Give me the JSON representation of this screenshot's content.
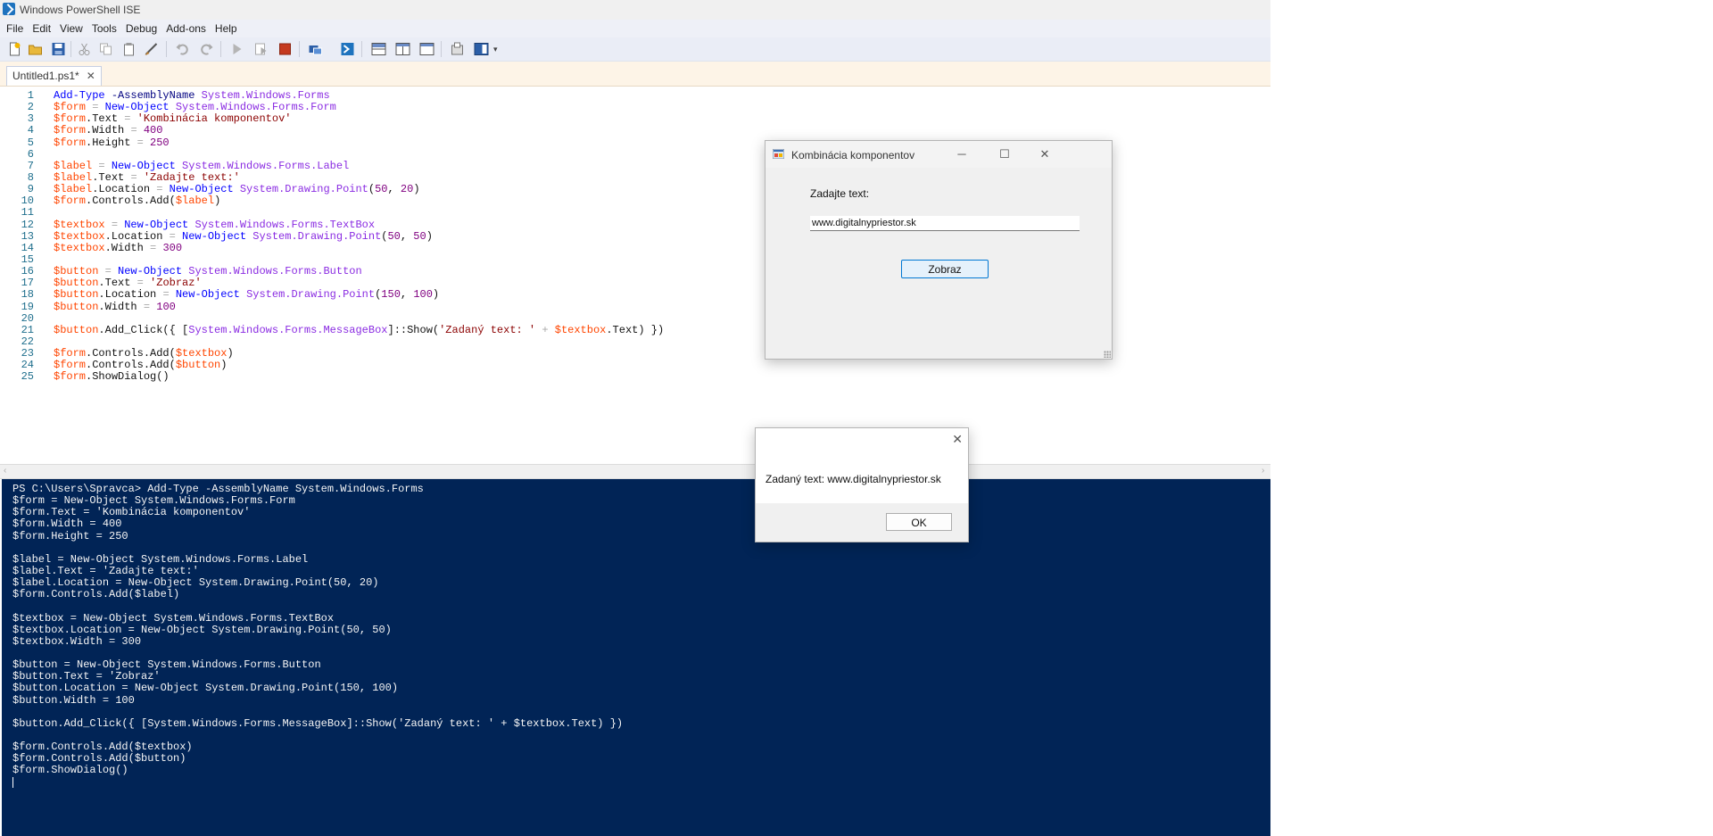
{
  "window": {
    "title": "Windows PowerShell ISE"
  },
  "menu": [
    "File",
    "Edit",
    "View",
    "Tools",
    "Debug",
    "Add-ons",
    "Help"
  ],
  "toolbar_icons": [
    "new-file-icon",
    "open-file-icon",
    "save-icon",
    "cut-icon",
    "copy-icon",
    "paste-icon",
    "clear-console-icon",
    "undo-icon",
    "redo-icon",
    "run-script-icon",
    "run-selection-icon",
    "stop-icon",
    "new-remote-tab-icon",
    "powershell-console-icon",
    "show-script-pane-top-icon",
    "show-script-pane-right-icon",
    "show-script-pane-maximized-icon",
    "command-addon-icon",
    "show-command-window-icon"
  ],
  "tab": {
    "label": "Untitled1.ps1*",
    "close": "✕"
  },
  "editor": {
    "lines": [
      [
        [
          "tk-cmd",
          "Add-Type"
        ],
        [
          "tk-text",
          " "
        ],
        [
          "tk-param",
          "-AssemblyName"
        ],
        [
          "tk-text",
          " "
        ],
        [
          "tk-type",
          "System.Windows.Forms"
        ]
      ],
      [
        [
          "tk-var",
          "$form"
        ],
        [
          "tk-text",
          " "
        ],
        [
          "tk-op",
          "="
        ],
        [
          "tk-text",
          " "
        ],
        [
          "tk-cmd",
          "New-Object"
        ],
        [
          "tk-text",
          " "
        ],
        [
          "tk-type",
          "System.Windows.Forms.Form"
        ]
      ],
      [
        [
          "tk-var",
          "$form"
        ],
        [
          "tk-mem",
          ".Text "
        ],
        [
          "tk-op",
          "="
        ],
        [
          "tk-text",
          " "
        ],
        [
          "tk-str",
          "'Kombinácia komponentov'"
        ]
      ],
      [
        [
          "tk-var",
          "$form"
        ],
        [
          "tk-mem",
          ".Width "
        ],
        [
          "tk-op",
          "="
        ],
        [
          "tk-text",
          " "
        ],
        [
          "tk-num",
          "400"
        ]
      ],
      [
        [
          "tk-var",
          "$form"
        ],
        [
          "tk-mem",
          ".Height "
        ],
        [
          "tk-op",
          "="
        ],
        [
          "tk-text",
          " "
        ],
        [
          "tk-num",
          "250"
        ]
      ],
      [],
      [
        [
          "tk-var",
          "$label"
        ],
        [
          "tk-text",
          " "
        ],
        [
          "tk-op",
          "="
        ],
        [
          "tk-text",
          " "
        ],
        [
          "tk-cmd",
          "New-Object"
        ],
        [
          "tk-text",
          " "
        ],
        [
          "tk-type",
          "System.Windows.Forms.Label"
        ]
      ],
      [
        [
          "tk-var",
          "$label"
        ],
        [
          "tk-mem",
          ".Text "
        ],
        [
          "tk-op",
          "="
        ],
        [
          "tk-text",
          " "
        ],
        [
          "tk-str",
          "'Zadajte text:'"
        ]
      ],
      [
        [
          "tk-var",
          "$label"
        ],
        [
          "tk-mem",
          ".Location "
        ],
        [
          "tk-op",
          "="
        ],
        [
          "tk-text",
          " "
        ],
        [
          "tk-cmd",
          "New-Object"
        ],
        [
          "tk-text",
          " "
        ],
        [
          "tk-type",
          "System.Drawing.Point"
        ],
        [
          "tk-text",
          "("
        ],
        [
          "tk-num",
          "50"
        ],
        [
          "tk-text",
          ", "
        ],
        [
          "tk-num",
          "20"
        ],
        [
          "tk-text",
          ")"
        ]
      ],
      [
        [
          "tk-var",
          "$form"
        ],
        [
          "tk-mem",
          ".Controls.Add("
        ],
        [
          "tk-var",
          "$label"
        ],
        [
          "tk-text",
          ")"
        ]
      ],
      [],
      [
        [
          "tk-var",
          "$textbox"
        ],
        [
          "tk-text",
          " "
        ],
        [
          "tk-op",
          "="
        ],
        [
          "tk-text",
          " "
        ],
        [
          "tk-cmd",
          "New-Object"
        ],
        [
          "tk-text",
          " "
        ],
        [
          "tk-type",
          "System.Windows.Forms.TextBox"
        ]
      ],
      [
        [
          "tk-var",
          "$textbox"
        ],
        [
          "tk-mem",
          ".Location "
        ],
        [
          "tk-op",
          "="
        ],
        [
          "tk-text",
          " "
        ],
        [
          "tk-cmd",
          "New-Object"
        ],
        [
          "tk-text",
          " "
        ],
        [
          "tk-type",
          "System.Drawing.Point"
        ],
        [
          "tk-text",
          "("
        ],
        [
          "tk-num",
          "50"
        ],
        [
          "tk-text",
          ", "
        ],
        [
          "tk-num",
          "50"
        ],
        [
          "tk-text",
          ")"
        ]
      ],
      [
        [
          "tk-var",
          "$textbox"
        ],
        [
          "tk-mem",
          ".Width "
        ],
        [
          "tk-op",
          "="
        ],
        [
          "tk-text",
          " "
        ],
        [
          "tk-num",
          "300"
        ]
      ],
      [],
      [
        [
          "tk-var",
          "$button"
        ],
        [
          "tk-text",
          " "
        ],
        [
          "tk-op",
          "="
        ],
        [
          "tk-text",
          " "
        ],
        [
          "tk-cmd",
          "New-Object"
        ],
        [
          "tk-text",
          " "
        ],
        [
          "tk-type",
          "System.Windows.Forms.Button"
        ]
      ],
      [
        [
          "tk-var",
          "$button"
        ],
        [
          "tk-mem",
          ".Text "
        ],
        [
          "tk-op",
          "="
        ],
        [
          "tk-text",
          " "
        ],
        [
          "tk-str",
          "'Zobraz'"
        ]
      ],
      [
        [
          "tk-var",
          "$button"
        ],
        [
          "tk-mem",
          ".Location "
        ],
        [
          "tk-op",
          "="
        ],
        [
          "tk-text",
          " "
        ],
        [
          "tk-cmd",
          "New-Object"
        ],
        [
          "tk-text",
          " "
        ],
        [
          "tk-type",
          "System.Drawing.Point"
        ],
        [
          "tk-text",
          "("
        ],
        [
          "tk-num",
          "150"
        ],
        [
          "tk-text",
          ", "
        ],
        [
          "tk-num",
          "100"
        ],
        [
          "tk-text",
          ")"
        ]
      ],
      [
        [
          "tk-var",
          "$button"
        ],
        [
          "tk-mem",
          ".Width "
        ],
        [
          "tk-op",
          "="
        ],
        [
          "tk-text",
          " "
        ],
        [
          "tk-num",
          "100"
        ]
      ],
      [],
      [
        [
          "tk-var",
          "$button"
        ],
        [
          "tk-mem",
          ".Add_Click({ "
        ],
        [
          "tk-text",
          "["
        ],
        [
          "tk-type",
          "System.Windows.Forms.MessageBox"
        ],
        [
          "tk-text",
          "]::Show("
        ],
        [
          "tk-str",
          "'Zadaný text: '"
        ],
        [
          "tk-text",
          " "
        ],
        [
          "tk-op",
          "+"
        ],
        [
          "tk-text",
          " "
        ],
        [
          "tk-var",
          "$textbox"
        ],
        [
          "tk-mem",
          ".Text) })"
        ]
      ],
      [],
      [
        [
          "tk-var",
          "$form"
        ],
        [
          "tk-mem",
          ".Controls.Add("
        ],
        [
          "tk-var",
          "$textbox"
        ],
        [
          "tk-text",
          ")"
        ]
      ],
      [
        [
          "tk-var",
          "$form"
        ],
        [
          "tk-mem",
          ".Controls.Add("
        ],
        [
          "tk-var",
          "$button"
        ],
        [
          "tk-text",
          ")"
        ]
      ],
      [
        [
          "tk-var",
          "$form"
        ],
        [
          "tk-mem",
          ".ShowDialog()"
        ]
      ]
    ]
  },
  "console": {
    "lines": [
      "PS C:\\Users\\Spravca> Add-Type -AssemblyName System.Windows.Forms",
      "$form = New-Object System.Windows.Forms.Form",
      "$form.Text = 'Kombinácia komponentov'",
      "$form.Width = 400",
      "$form.Height = 250",
      "",
      "$label = New-Object System.Windows.Forms.Label",
      "$label.Text = 'Zadajte text:'",
      "$label.Location = New-Object System.Drawing.Point(50, 20)",
      "$form.Controls.Add($label)",
      "",
      "$textbox = New-Object System.Windows.Forms.TextBox",
      "$textbox.Location = New-Object System.Drawing.Point(50, 50)",
      "$textbox.Width = 300",
      "",
      "$button = New-Object System.Windows.Forms.Button",
      "$button.Text = 'Zobraz'",
      "$button.Location = New-Object System.Drawing.Point(150, 100)",
      "$button.Width = 100",
      "",
      "$button.Add_Click({ [System.Windows.Forms.MessageBox]::Show('Zadaný text: ' + $textbox.Text) })",
      "",
      "$form.Controls.Add($textbox)",
      "$form.Controls.Add($button)",
      "$form.ShowDialog()"
    ]
  },
  "form_window": {
    "title": "Kombinácia komponentov",
    "label": "Zadajte text:",
    "textbox_value": "www.digitalnypriestor.sk",
    "button": "Zobraz",
    "minimize": "─",
    "maximize": "☐",
    "close": "✕"
  },
  "message_box": {
    "text": "Zadaný text: www.digitalnypriestor.sk",
    "ok": "OK",
    "close": "✕"
  },
  "colors": {
    "console_bg": "#012456",
    "accent": "#0078d4"
  }
}
